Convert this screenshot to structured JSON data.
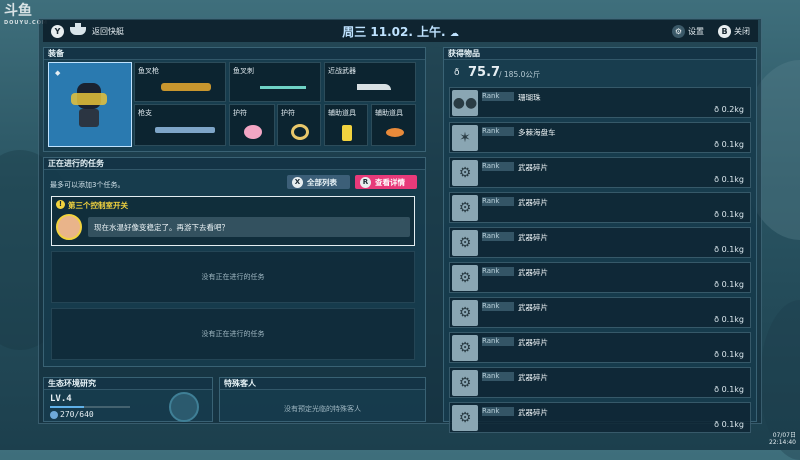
{
  "watermark": {
    "brand": "斗鱼",
    "sub": "DOUYU.COM"
  },
  "topbar": {
    "back_key": "Y",
    "back_label": "返回快艇",
    "date": "周三 11.02. 上午.",
    "weather_icon": "cloud-rain-icon",
    "settings_key": "⚙",
    "settings_label": "设置",
    "close_key": "B",
    "close_label": "关闭"
  },
  "equipment": {
    "title": "装备",
    "slots": [
      {
        "label": "鱼叉枪"
      },
      {
        "label": "鱼叉刺"
      },
      {
        "label": "近战武器"
      },
      {
        "label": "枪支"
      },
      {
        "label": "护符"
      },
      {
        "label": "护符"
      },
      {
        "label": "辅助道具"
      },
      {
        "label": "辅助道具"
      }
    ]
  },
  "quests": {
    "title": "正在进行的任务",
    "hint": "最多可以添加3个任务。",
    "btn_all_key": "X",
    "btn_all": "全部列表",
    "btn_detail_key": "R",
    "btn_detail": "查看详情",
    "active_title": "第三个控制室开关",
    "active_text": "现在水温好像变稳定了。再游下去看吧？",
    "empty1": "没有正在进行的任务",
    "empty2": "没有正在进行的任务"
  },
  "eco": {
    "title": "生态环境研究",
    "level": "LV.4",
    "progress": "270/640",
    "progress_fraction": 0.42
  },
  "guests": {
    "title": "特殊客人",
    "empty": "没有预定光临的特殊客人"
  },
  "loot": {
    "title": "获得物品",
    "weight": "75.7",
    "capacity": "/ 185.0公斤",
    "rank_label": "Rank",
    "items": [
      {
        "name": "珊瑚珠",
        "weight": "0.2kg",
        "icon": "pearl-icon"
      },
      {
        "name": "多棘海盘车",
        "weight": "0.1kg",
        "icon": "starfish-icon"
      },
      {
        "name": "武器碎片",
        "weight": "0.1kg",
        "icon": "scrap-icon"
      },
      {
        "name": "武器碎片",
        "weight": "0.1kg",
        "icon": "scrap-icon"
      },
      {
        "name": "武器碎片",
        "weight": "0.1kg",
        "icon": "scrap-icon"
      },
      {
        "name": "武器碎片",
        "weight": "0.1kg",
        "icon": "scrap-icon"
      },
      {
        "name": "武器碎片",
        "weight": "0.1kg",
        "icon": "scrap-icon"
      },
      {
        "name": "武器碎片",
        "weight": "0.1kg",
        "icon": "scrap-icon"
      },
      {
        "name": "武器碎片",
        "weight": "0.1kg",
        "icon": "scrap-icon"
      },
      {
        "name": "武器碎片",
        "weight": "0.1kg",
        "icon": "scrap-icon"
      }
    ]
  },
  "clock": {
    "date": "07/07日",
    "time": "22:14:40"
  }
}
